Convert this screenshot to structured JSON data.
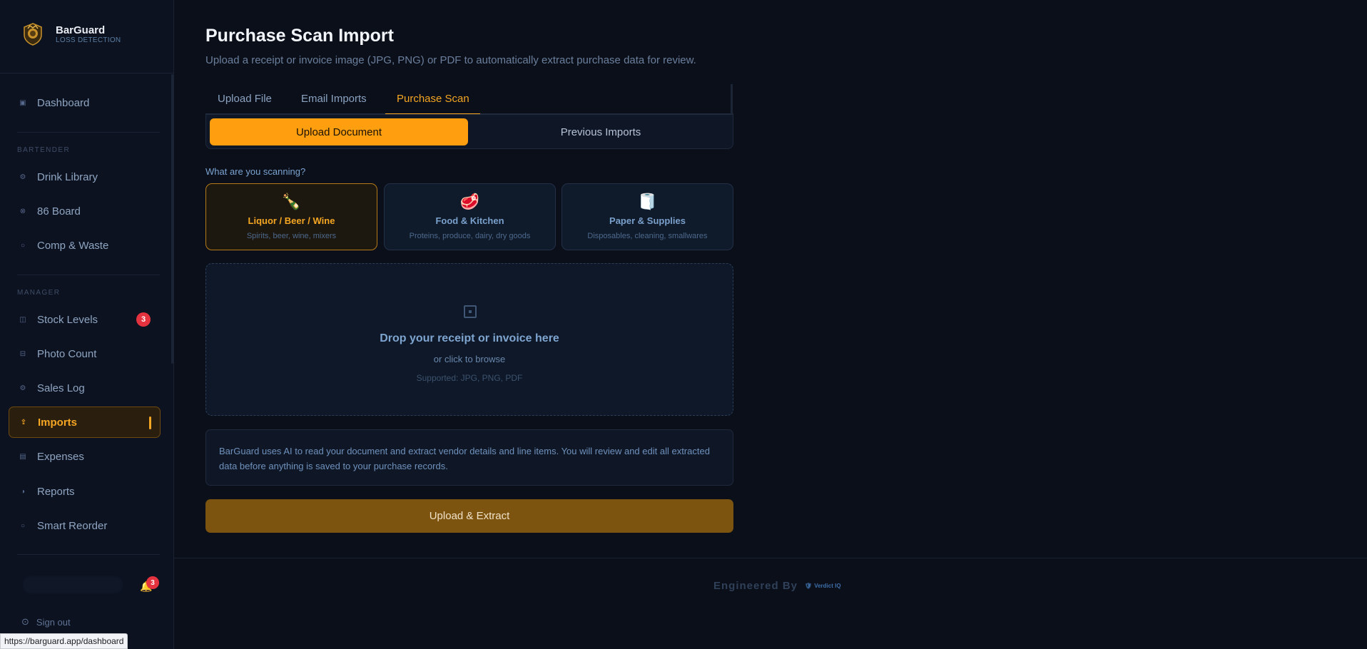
{
  "brand": {
    "name": "BarGuard",
    "tagline": "LOSS DETECTION",
    "logo_icon": "lion-crest-icon"
  },
  "sidebar": {
    "dashboard": {
      "label": "Dashboard",
      "icon": "grid-icon"
    },
    "sections": [
      {
        "label": "BARTENDER"
      },
      {
        "label": "MANAGER"
      }
    ],
    "bartender_items": [
      {
        "label": "Drink Library",
        "icon": "gear-icon"
      },
      {
        "label": "86 Board",
        "icon": "x-circle-icon"
      },
      {
        "label": "Comp & Waste",
        "icon": "circle-icon"
      }
    ],
    "manager_items": [
      {
        "label": "Stock Levels",
        "icon": "columns-icon",
        "badge": "3"
      },
      {
        "label": "Photo Count",
        "icon": "camera-icon"
      },
      {
        "label": "Sales Log",
        "icon": "gear-icon"
      },
      {
        "label": "Imports",
        "icon": "import-icon",
        "active": true
      },
      {
        "label": "Expenses",
        "icon": "receipt-icon"
      },
      {
        "label": "Reports",
        "icon": "half-circle-icon"
      },
      {
        "label": "Smart Reorder",
        "icon": "refresh-icon"
      }
    ],
    "notifications_badge": "3",
    "sign_out": "Sign out"
  },
  "status_bar": {
    "url": "https://barguard.app/dashboard"
  },
  "page": {
    "title": "Purchase Scan Import",
    "subtitle": "Upload a receipt or invoice image (JPG, PNG) or PDF to automatically extract purchase data for review."
  },
  "tabs": [
    {
      "label": "Upload File"
    },
    {
      "label": "Email Imports"
    },
    {
      "label": "Purchase Scan",
      "active": true
    }
  ],
  "segmented": {
    "upload": "Upload Document",
    "previous": "Previous Imports"
  },
  "scan_question": "What are you scanning?",
  "categories": [
    {
      "icon": "🍾",
      "title": "Liquor / Beer / Wine",
      "subtitle": "Spirits, beer, wine, mixers",
      "selected": true
    },
    {
      "icon": "🥩",
      "title": "Food & Kitchen",
      "subtitle": "Proteins, produce, dairy, dry goods"
    },
    {
      "icon": "🧻",
      "title": "Paper & Supplies",
      "subtitle": "Disposables, cleaning, smallwares"
    }
  ],
  "dropzone": {
    "title": "Drop your receipt or invoice here",
    "subtitle": "or click to browse",
    "formats": "Supported: JPG, PNG, PDF"
  },
  "info_text": "BarGuard uses AI to read your document and extract vendor details and line items. You will review and edit all extracted data before anything is saved to your purchase records.",
  "primary_button": "Upload & Extract",
  "footer": {
    "engineered_by": "Engineered By",
    "partner_logo_text": "Verdict IQ"
  },
  "colors": {
    "accent": "#f5a623",
    "background": "#0a0f1a",
    "badge": "#e5323f"
  }
}
